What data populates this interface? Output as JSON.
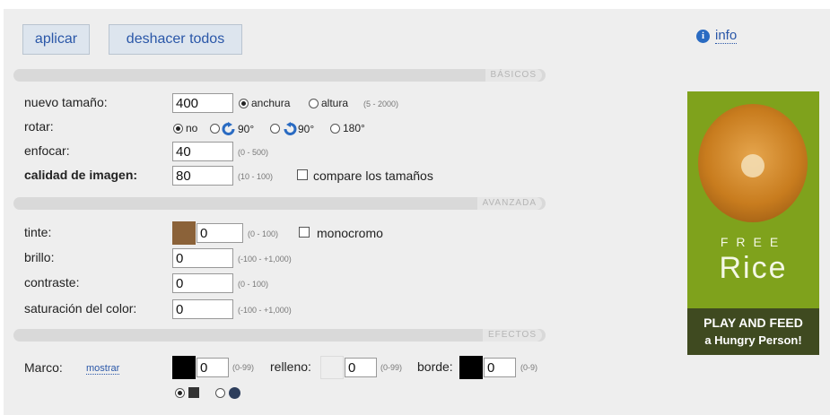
{
  "toolbar": {
    "apply_label": "aplicar",
    "undo_all_label": "deshacer todos"
  },
  "info": {
    "icon": "info-icon",
    "label": "info"
  },
  "sections": {
    "basic": "BÁSICOS",
    "advanced": "AVANZADA",
    "effects": "EFECTOS"
  },
  "basic": {
    "new_size": {
      "label": "nuevo tamaño:",
      "value": "400",
      "opt_width": "anchura",
      "opt_height": "altura",
      "hint": "(5 - 2000)",
      "selected": "anchura"
    },
    "rotate": {
      "label": "rotar:",
      "opt_no": "no",
      "opt_90cw": "90°",
      "opt_90ccw": "90°",
      "opt_180": "180°",
      "selected": "no"
    },
    "sharpen": {
      "label": "enfocar:",
      "value": "40",
      "hint": "(0 - 500)"
    },
    "quality": {
      "label": "calidad de imagen:",
      "value": "80",
      "hint": "(10 - 100)",
      "compare_label": "compare los tamaños",
      "compare_checked": false
    }
  },
  "advanced": {
    "tint": {
      "label": "tinte:",
      "value": "0",
      "hint": "(0 - 100)",
      "color": "#8b6239",
      "mono_label": "monocromo",
      "mono_checked": false
    },
    "brightness": {
      "label": "brillo:",
      "value": "0",
      "hint": "(-100 - +1,000)"
    },
    "contrast": {
      "label": "contraste:",
      "value": "0",
      "hint": "(0 - 100)"
    },
    "saturation": {
      "label": "saturación del color:",
      "value": "0",
      "hint": "(-100 - +1,000)"
    }
  },
  "effects": {
    "frame": {
      "label": "Marco:",
      "show_link": "mostrar",
      "color": "#000000",
      "value": "0",
      "hint": "(0-99)"
    },
    "padding": {
      "label": "relleno:",
      "color": "#eeeeee",
      "value": "0",
      "hint": "(0-99)"
    },
    "border": {
      "label": "borde:",
      "color": "#000000",
      "value": "0",
      "hint": "(0-9)"
    },
    "shape_options": [
      "square",
      "circle"
    ],
    "shape_selected": "square"
  },
  "ad": {
    "line1": "FREE",
    "line2": "Rice",
    "line3": "PLAY AND FEED",
    "line4": "a Hungry Person!"
  }
}
